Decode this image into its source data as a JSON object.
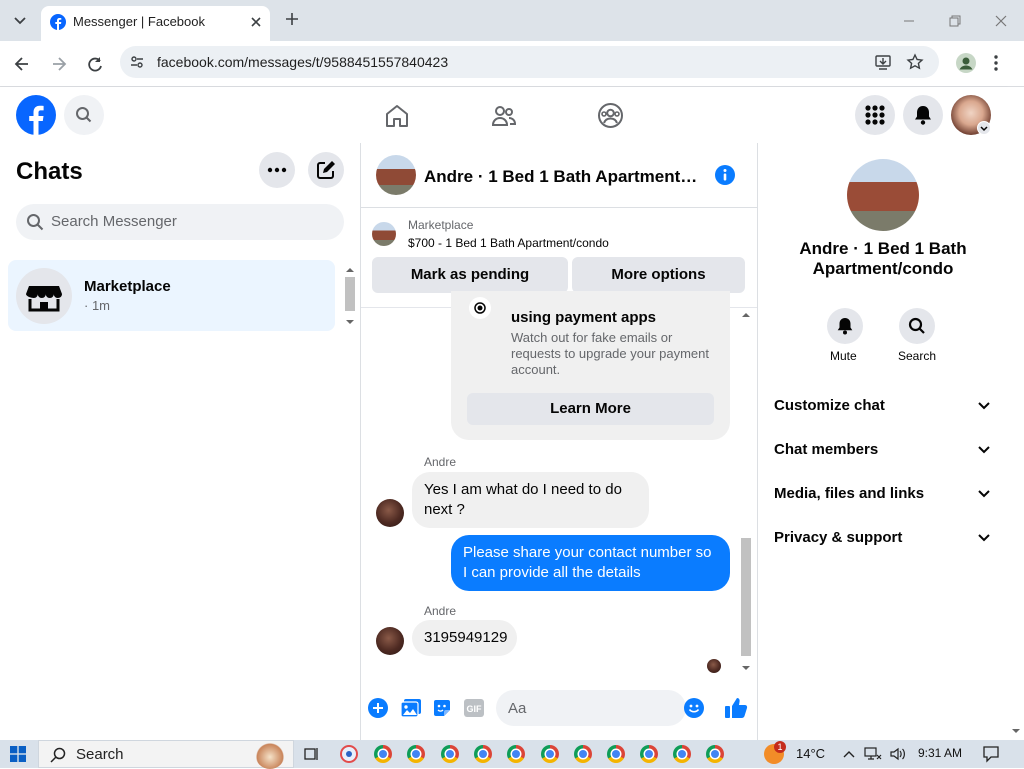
{
  "browser": {
    "tab_title": "Messenger | Facebook",
    "url": "facebook.com/messages/t/9588451557840423"
  },
  "left": {
    "title": "Chats",
    "search_placeholder": "Search Messenger",
    "chat_item": {
      "name": "Marketplace",
      "time": "· 1m"
    }
  },
  "conversation": {
    "name": "Andre · 1 Bed 1 Bath Apartment/condo",
    "marketplace": {
      "label": "Marketplace",
      "listing": "$700 - 1 Bed 1 Bath Apartment/condo",
      "pending_button": "Mark as pending",
      "options_button": "More options"
    },
    "tip": {
      "heading": "using payment apps",
      "body": "Watch out for fake emails or requests to upgrade your payment account.",
      "button": "Learn More"
    },
    "messages": [
      {
        "sender": "Andre",
        "text": "Yes I am what do I need to do next ?"
      },
      {
        "sender": "",
        "text": "Please share your contact number so I can provide all the details"
      },
      {
        "sender": "Andre",
        "text": "3195949129"
      }
    ],
    "composer_placeholder": "Aa"
  },
  "right": {
    "title": "Andre · 1 Bed 1 Bath Apartment/condo",
    "mute_label": "Mute",
    "search_label": "Search",
    "sections": [
      "Customize chat",
      "Chat members",
      "Media, files and links",
      "Privacy & support"
    ]
  },
  "taskbar": {
    "search_label": "Search",
    "weather": "14°C",
    "notif_count": "1",
    "time": "9:31 AM"
  },
  "colors": {
    "fb_blue": "#0866ff",
    "messenger_blue": "#0a7cff",
    "selected_chat": "#ebf5ff"
  }
}
